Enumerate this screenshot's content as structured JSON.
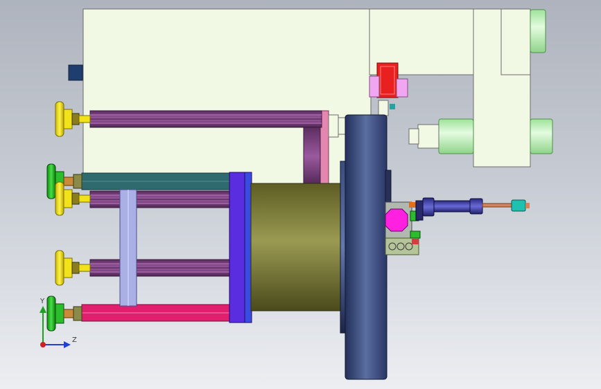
{
  "triad": {
    "y_label": "Y",
    "z_label": "Z"
  },
  "colors": {
    "background_top": "#aeb3bd",
    "background_bottom": "#eceef2",
    "frame_plate": "#f1f9e4",
    "feet_yellow": "#f2e21a",
    "feet_green": "#2cbd2c",
    "beam_purple": "#7a3f7e",
    "beam_teal": "#2f6a6e",
    "beam_magenta": "#e0206e",
    "flange_blue": "#5a2ee0",
    "drum_olive": "#7a7a34",
    "disk_navy": "#2b3a6a",
    "red_block": "#e82020",
    "pink_block": "#f0a6f0",
    "cylinder_blue": "#3a3aa8",
    "light_green_pipe": "#b6f0b0"
  }
}
